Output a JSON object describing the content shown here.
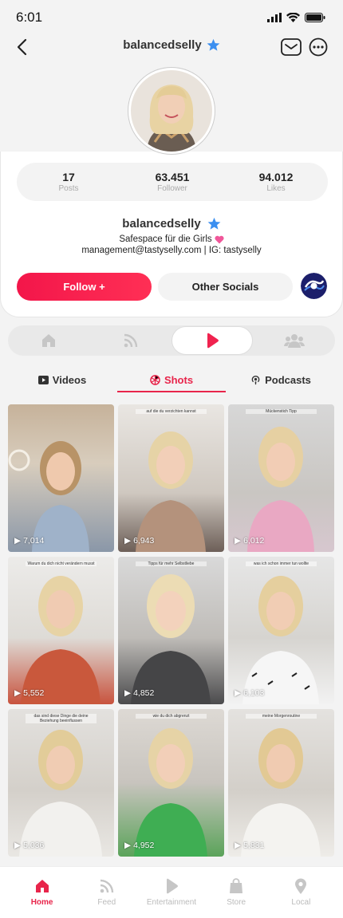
{
  "status_bar": {
    "time": "6:01"
  },
  "header": {
    "title": "balancedselly"
  },
  "stats": [
    {
      "value": "17",
      "label": "Posts"
    },
    {
      "value": "63.451",
      "label": "Follower"
    },
    {
      "value": "94.012",
      "label": "Likes"
    }
  ],
  "profile": {
    "name": "balancedselly",
    "bio_line1": "Safespace für die Girls",
    "bio_line2": "management@tastyselly.com | IG: tastyselly"
  },
  "actions": {
    "follow_label": "Follow +",
    "other_socials_label": "Other Socials"
  },
  "content_tabs": [
    {
      "label": "Videos",
      "icon": "play-square-icon"
    },
    {
      "label": "Shots",
      "icon": "shots-icon"
    },
    {
      "label": "Podcasts",
      "icon": "podcast-icon"
    }
  ],
  "shots": [
    {
      "views": "7,014",
      "caption": ""
    },
    {
      "views": "6,943",
      "caption": "auf die du verzichten kannst"
    },
    {
      "views": "6,012",
      "caption": "Mückenstich Tipp"
    },
    {
      "views": "5,552",
      "caption": "Warum du dich nicht verändern musst"
    },
    {
      "views": "4,852",
      "caption": "Tipps für mehr Selbstliebe"
    },
    {
      "views": "6,103",
      "caption": "was ich schon immer tun wollte"
    },
    {
      "views": "5,036",
      "caption": "das sind diese Dinge die deine Beziehung beeinflussen"
    },
    {
      "views": "4,952",
      "caption": "wie du dich abgrenzt"
    },
    {
      "views": "5,831",
      "caption": "meine Morgenroutine"
    }
  ],
  "bottom_nav": [
    {
      "label": "Home",
      "icon": "home-icon",
      "active": true
    },
    {
      "label": "Feed",
      "icon": "feed-icon",
      "active": false
    },
    {
      "label": "Entertainment",
      "icon": "play-icon",
      "active": false
    },
    {
      "label": "Store",
      "icon": "bag-icon",
      "active": false
    },
    {
      "label": "Local",
      "icon": "location-icon",
      "active": false
    }
  ],
  "colors": {
    "accent": "#e8254b",
    "verified": "#3b8ff0",
    "muted": "#aaaaaa"
  }
}
